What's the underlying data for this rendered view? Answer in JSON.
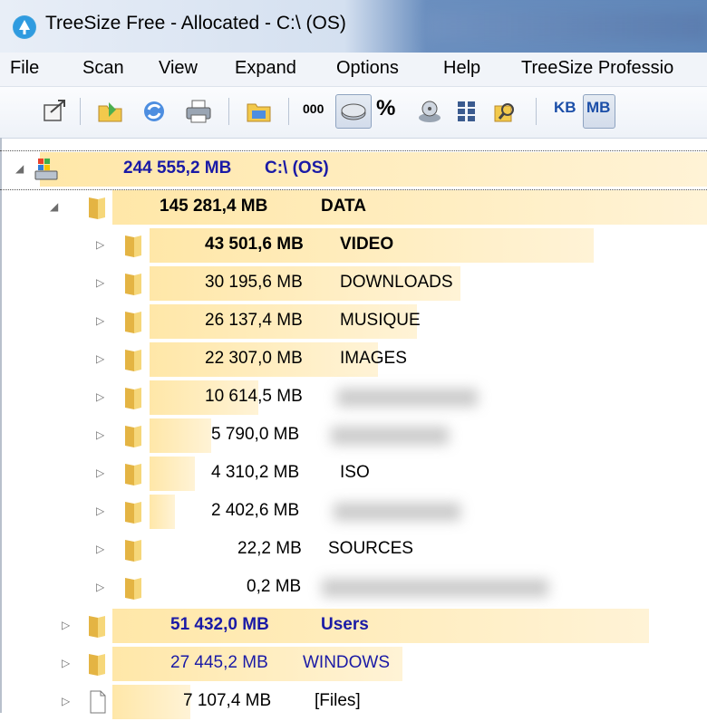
{
  "window": {
    "title": "TreeSize Free - Allocated - C:\\  (OS)",
    "app_icon": "treesize-icon"
  },
  "menu": {
    "items": [
      "File",
      "Scan",
      "View",
      "Expand",
      "Options",
      "Help",
      "TreeSize Professio"
    ]
  },
  "toolbar": {
    "buttons": [
      "open-icon",
      "scan-folder-icon",
      "refresh-icon",
      "print-icon",
      "save-icon",
      "percent-icon",
      "disk-icon",
      "files-icon",
      "owner-icon"
    ],
    "number_format_label": "000",
    "percent_label": "%",
    "kb_label": "KB",
    "mb_label": "MB"
  },
  "colors": {
    "bar": "#ffe7a8",
    "folder": "#f2c94c",
    "link_blue": "#1a1aa6"
  },
  "tree": {
    "root": {
      "size": "244 555,2 MB",
      "name": "C:\\  (OS)",
      "fraction": 1.0
    },
    "rows": [
      {
        "size": "145 281,4 MB",
        "name": "DATA",
        "level": 1,
        "fraction": 1.0
      },
      {
        "size": "43 501,6 MB",
        "name": "VIDEO",
        "level": 2,
        "fraction": 0.8
      },
      {
        "size": "30 195,6 MB",
        "name": "DOWNLOADS",
        "level": 2,
        "fraction": 0.56
      },
      {
        "size": "26 137,4 MB",
        "name": "MUSIQUE",
        "level": 2,
        "fraction": 0.48
      },
      {
        "size": "22 307,0 MB",
        "name": "IMAGES",
        "level": 2,
        "fraction": 0.41
      },
      {
        "size": "10 614,5 MB",
        "name": "",
        "level": 2,
        "fraction": 0.19
      },
      {
        "size": "5 790,0 MB",
        "name": "",
        "level": 2,
        "fraction": 0.11
      },
      {
        "size": "4 310,2 MB",
        "name": "ISO",
        "level": 2,
        "fraction": 0.08
      },
      {
        "size": "2 402,6 MB",
        "name": "",
        "level": 2,
        "fraction": 0.045
      },
      {
        "size": "22,2 MB",
        "name": "SOURCES",
        "level": 2,
        "fraction": 0.0
      },
      {
        "size": "0,2 MB",
        "name": "",
        "level": 2,
        "fraction": 0.0
      },
      {
        "size": "51 432,0 MB",
        "name": "Users",
        "level": 1,
        "fraction": 0.92
      },
      {
        "size": "27 445,2 MB",
        "name": "WINDOWS",
        "level": 1,
        "fraction": 0.49
      },
      {
        "size": "7 107,4 MB",
        "name": "[Files]",
        "level": 1,
        "fraction": 0.13
      }
    ]
  }
}
